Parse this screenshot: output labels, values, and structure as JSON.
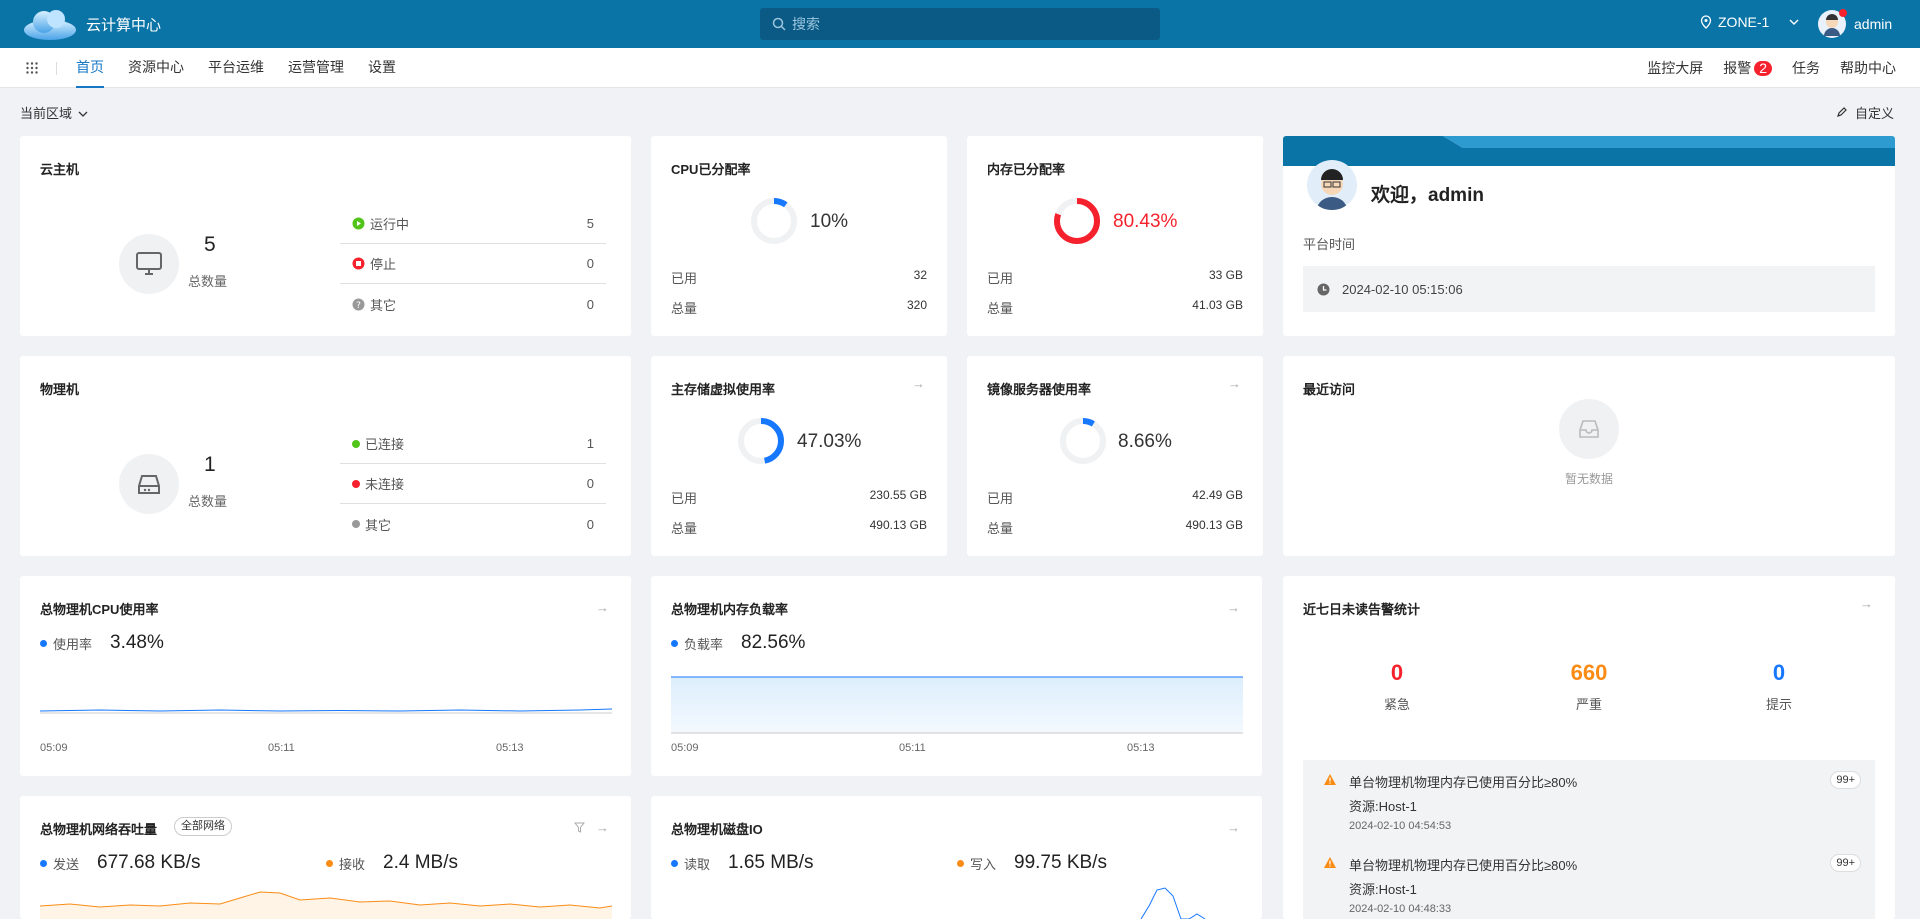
{
  "header": {
    "app_title": "云计算中心",
    "search_placeholder": "搜索",
    "zone": "ZONE-1",
    "username": "admin"
  },
  "nav": {
    "items": [
      "首页",
      "资源中心",
      "平台运维",
      "运营管理",
      "设置"
    ],
    "active": "首页",
    "right": {
      "monitor": "监控大屏",
      "alarm": "报警",
      "alarm_count": "2",
      "tasks": "任务",
      "help": "帮助中心"
    }
  },
  "toolbar": {
    "region": "当前区域",
    "customize": "自定义"
  },
  "vm": {
    "title": "云主机",
    "total": "5",
    "total_label": "总数量",
    "rows": [
      {
        "label": "运行中",
        "value": "5",
        "color": "#52c41a"
      },
      {
        "label": "停止",
        "value": "0",
        "color": "#f5222d"
      },
      {
        "label": "其它",
        "value": "0",
        "color": "#999999"
      }
    ]
  },
  "host": {
    "title": "物理机",
    "total": "1",
    "total_label": "总数量",
    "rows": [
      {
        "label": "已连接",
        "value": "1",
        "color": "#52c41a"
      },
      {
        "label": "未连接",
        "value": "0",
        "color": "#f5222d"
      },
      {
        "label": "其它",
        "value": "0",
        "color": "#999999"
      }
    ]
  },
  "cpu_alloc": {
    "title": "CPU已分配率",
    "percent": "10%",
    "fraction": 0.1,
    "color": "#1677ff",
    "used_label": "已用",
    "used": "32",
    "total_label": "总量",
    "total": "320"
  },
  "mem_alloc": {
    "title": "内存已分配率",
    "percent": "80.43%",
    "fraction": 0.8043,
    "color": "#f5222d",
    "used_label": "已用",
    "used": "33 GB",
    "total_label": "总量",
    "total": "41.03 GB"
  },
  "primary_storage": {
    "title": "主存储虚拟使用率",
    "percent": "47.03%",
    "fraction": 0.4703,
    "color": "#1677ff",
    "used_label": "已用",
    "used": "230.55 GB",
    "total_label": "总量",
    "total": "490.13 GB"
  },
  "image_server": {
    "title": "镜像服务器使用率",
    "percent": "8.66%",
    "fraction": 0.0866,
    "color": "#1677ff",
    "used_label": "已用",
    "used": "42.49 GB",
    "total_label": "总量",
    "total": "490.13 GB"
  },
  "welcome": {
    "greeting": "欢迎，admin",
    "time_label": "平台时间",
    "time": "2024-02-10 05:15:06"
  },
  "recent": {
    "title": "最近访问",
    "empty": "暂无数据"
  },
  "host_cpu": {
    "title": "总物理机CPU使用率",
    "legend": "使用率",
    "value": "3.48%",
    "ticks": [
      "05:09",
      "05:11",
      "05:13"
    ]
  },
  "host_mem": {
    "title": "总物理机内存负载率",
    "legend": "负载率",
    "value": "82.56%",
    "ticks": [
      "05:09",
      "05:11",
      "05:13"
    ]
  },
  "network": {
    "title": "总物理机网络吞吐量",
    "tag": "全部网络",
    "send_label": "发送",
    "send": "677.68 KB/s",
    "recv_label": "接收",
    "recv": "2.4 MB/s"
  },
  "disk": {
    "title": "总物理机磁盘IO",
    "read_label": "读取",
    "read": "1.65 MB/s",
    "write_label": "写入",
    "write": "99.75 KB/s"
  },
  "alarms": {
    "title": "近七日未读告警统计",
    "counts": [
      {
        "label": "紧急",
        "value": "0",
        "color": "#f5222d"
      },
      {
        "label": "严重",
        "value": "660",
        "color": "#fa8c16"
      },
      {
        "label": "提示",
        "value": "0",
        "color": "#1677ff"
      }
    ],
    "items": [
      {
        "title": "单台物理机物理内存已使用百分比≥80%",
        "resource": "资源:Host-1",
        "time": "2024-02-10 04:54:53",
        "count": "99+"
      },
      {
        "title": "单台物理机物理内存已使用百分比≥80%",
        "resource": "资源:Host-1",
        "time": "2024-02-10 04:48:33",
        "count": "99+"
      }
    ]
  },
  "colors": {
    "topbar": "#0b74a6",
    "accent": "#1677c5",
    "orange": "#fa8c16"
  }
}
